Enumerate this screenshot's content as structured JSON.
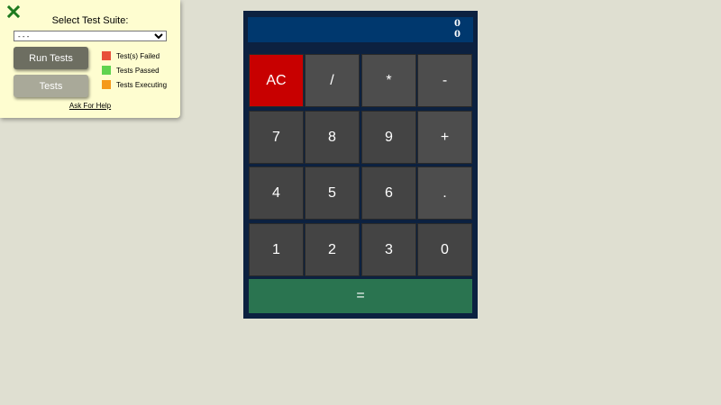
{
  "test_panel": {
    "title": "Select Test Suite:",
    "select_value": "- - -",
    "run_tests_label": "Run Tests",
    "tests_label": "Tests",
    "legend": [
      {
        "label": "Test(s) Failed",
        "color": "#e8503a"
      },
      {
        "label": "Tests Passed",
        "color": "#5fd34f"
      },
      {
        "label": "Tests Executing",
        "color": "#f59a1b"
      }
    ],
    "help_link": "Ask For Help",
    "close_icon": "close-x-icon",
    "close_color": "#1e7a1e"
  },
  "calculator": {
    "display_line1": "0",
    "display_line2": "0",
    "keys": {
      "ac": "AC",
      "divide": "/",
      "multiply": "*",
      "subtract": "-",
      "seven": "7",
      "eight": "8",
      "nine": "9",
      "add": "+",
      "four": "4",
      "five": "5",
      "six": "6",
      "decimal": ".",
      "one": "1",
      "two": "2",
      "three": "3",
      "zero": "0",
      "equals": "="
    },
    "colors": {
      "body": "#0c2140",
      "display": "#00386e",
      "key": "#444444",
      "clear": "#c80000",
      "equals": "#2a7450"
    }
  }
}
